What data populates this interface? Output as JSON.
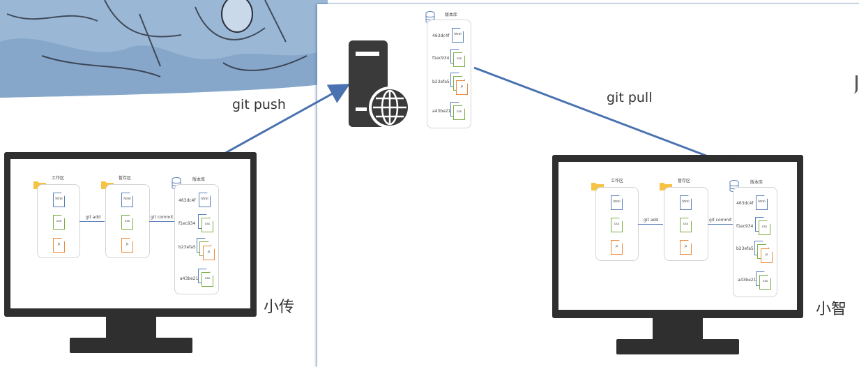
{
  "arrows": {
    "push_label": "git push",
    "pull_label": "git pull"
  },
  "users": {
    "left_name": "小传",
    "right_name": "小智"
  },
  "server_repo": {
    "title": "版本库",
    "commits": [
      "463dc4f",
      "f1ec934",
      "b23efa5",
      "a43be21"
    ]
  },
  "diagram": {
    "workspace": "工作区",
    "staging": "暂存区",
    "repo": "版本库",
    "git_add": "git add",
    "git_commit": "git commit",
    "files": {
      "html": "html",
      "css": "css",
      "js": "js"
    },
    "commits": [
      "463dc4f",
      "f1ec934",
      "b23efa5",
      "a43be21"
    ]
  },
  "colors": {
    "arrow": "#4a72b0",
    "monitor": "#2f2f2f",
    "doc_blue": "#5a7fb8",
    "doc_green": "#7bae47",
    "doc_orange": "#ee8a3b",
    "folder": "#f6c344"
  }
}
